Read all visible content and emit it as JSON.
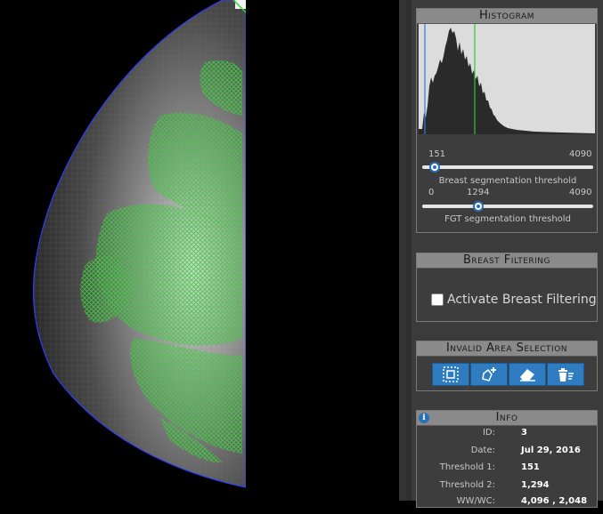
{
  "histogram": {
    "title": "Histogram",
    "breast_slider": {
      "min_label": "151",
      "max_label": "4090",
      "label": "Breast segmentation threshold",
      "value": 151,
      "min": 0,
      "max": 4090
    },
    "fgt_slider": {
      "min_label": "0",
      "center_label": "1294",
      "max_label": "4090",
      "label": "FGT segmentation threshold",
      "value": 1294,
      "min": 0,
      "max": 4090
    }
  },
  "breast_filtering": {
    "title": "Breast Filtering",
    "checkbox_label": "Activate Breast Filtering",
    "checked": false
  },
  "invalid_area": {
    "title": "Invalid Area Selection",
    "tools": [
      "select-rect-icon",
      "add-polygon-icon",
      "eraser-icon",
      "delete-all-icon"
    ]
  },
  "info": {
    "title": "Info",
    "rows": [
      {
        "key": "ID:",
        "value": "3"
      },
      {
        "key": "Date:",
        "value": "Jul 29, 2016"
      },
      {
        "key": "Threshold 1:",
        "value": "151"
      },
      {
        "key": "Threshold 2:",
        "value": "1,294"
      },
      {
        "key": "WW/WC:",
        "value": "4,096 , 2,048"
      }
    ]
  },
  "colors": {
    "accent": "#2f7cc1",
    "overlay": "#39d239",
    "panel_header": "#8a8a8a"
  }
}
